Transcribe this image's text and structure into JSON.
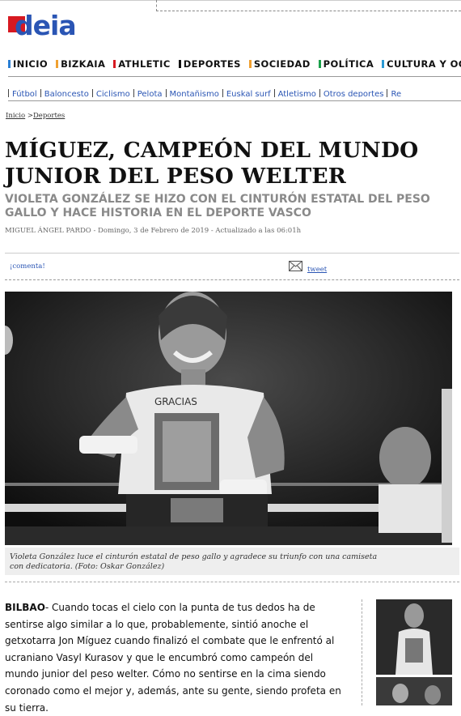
{
  "site": {
    "logo_text": "deia"
  },
  "main_nav": [
    {
      "label": "INICIO",
      "color": "#2a7fd4"
    },
    {
      "label": "BIZKAIA",
      "color": "#f0a030"
    },
    {
      "label": "ATHLETIC",
      "color": "#d71921"
    },
    {
      "label": "DEPORTES",
      "color": "#111111"
    },
    {
      "label": "SOCIEDAD",
      "color": "#f0a030"
    },
    {
      "label": "POLÍTICA",
      "color": "#1aa04a"
    },
    {
      "label": "CULTURA Y OCIO",
      "color": "#2a9ad4"
    }
  ],
  "sub_nav": [
    {
      "label": "Fútbol"
    },
    {
      "label": "Baloncesto"
    },
    {
      "label": "Ciclismo"
    },
    {
      "label": "Pelota"
    },
    {
      "label": "Montañismo"
    },
    {
      "label": "Euskal surf"
    },
    {
      "label": "Atletismo"
    },
    {
      "label": "Otros deportes"
    },
    {
      "label": "Re"
    }
  ],
  "breadcrumb": {
    "home": "Inicio",
    "sep": ">",
    "section": "Deportes"
  },
  "article": {
    "title": "MÍGUEZ, CAMPEÓN DEL MUNDO JUNIOR DEL PESO WELTER",
    "subtitle": "VIOLETA GONZÁLEZ SE HIZO CON EL CINTURÓN ESTATAL DEL PESO GALLO Y HACE HISTORIA EN EL DEPORTE VASCO",
    "byline": "MIGUEL ÁNGEL PARDO - Domingo, 3 de Febrero de 2019 - Actualizado a las 06:01h",
    "comment_link": "¡comenta!",
    "tweet_link": "tweet",
    "caption": "Violeta González luce el cinturón estatal de peso gallo y agradece su triunfo con una camiseta con dedicatoria. (Foto: Oskar González)",
    "shirt_text": "GRACIAS",
    "body_lead": "BILBAO",
    "body_text": "- Cuando tocas el cielo con la punta de tus dedos ha de sentirse algo similar a lo que, probablemente, sintió anoche el getxotarra Jon Míguez cuando finalizó el combate que le enfrentó al ucraniano Vasyl Kurasov y que le encumbró como campeón del mundo junior del peso welter. Cómo no sentirse en la cima siendo coronado como el mejor y, además, ante su gente, siendo profeta en su tierra."
  }
}
